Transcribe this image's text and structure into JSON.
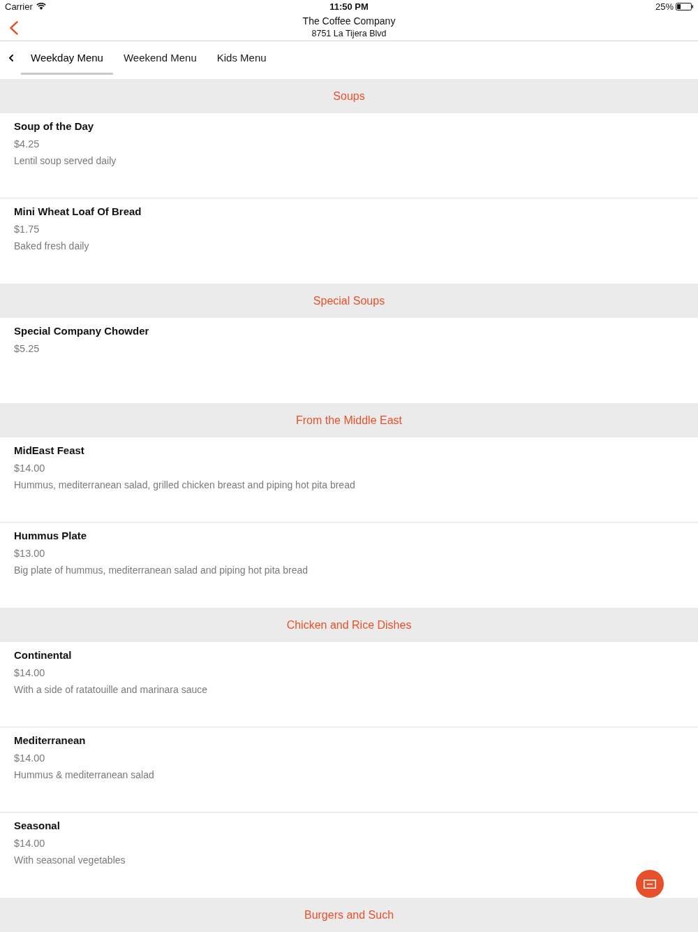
{
  "status_bar": {
    "carrier": "Carrier",
    "time": "11:50 PM",
    "battery": "25%"
  },
  "nav": {
    "title": "The Coffee Company",
    "subtitle": "8751 La Tijera Blvd"
  },
  "tabs": [
    {
      "label": "Weekday Menu",
      "selected": true
    },
    {
      "label": "Weekend Menu",
      "selected": false
    },
    {
      "label": "Kids Menu",
      "selected": false
    }
  ],
  "sections": [
    {
      "title": "Soups",
      "items": [
        {
          "name": "Soup of the Day",
          "price": "$4.25",
          "description": "Lentil soup served daily"
        },
        {
          "name": "Mini Wheat Loaf Of Bread",
          "price": "$1.75",
          "description": "Baked fresh daily"
        }
      ]
    },
    {
      "title": "Special Soups",
      "items": [
        {
          "name": "Special Company Chowder",
          "price": "$5.25"
        }
      ]
    },
    {
      "title": "From the Middle East",
      "items": [
        {
          "name": "MidEast Feast",
          "price": "$14.00",
          "description": "Hummus, mediterranean salad, grilled chicken breast and piping hot pita bread"
        },
        {
          "name": "Hummus Plate",
          "price": "$13.00",
          "description": "Big plate of hummus, mediterranean salad and piping hot pita bread"
        }
      ]
    },
    {
      "title": "Chicken and Rice Dishes",
      "items": [
        {
          "name": "Continental",
          "price": "$14.00",
          "description": "With a side of ratatouille and marinara sauce"
        },
        {
          "name": "Mediterranean",
          "price": "$14.00",
          "description": "Hummus & mediterranean salad"
        },
        {
          "name": "Seasonal",
          "price": "$14.00",
          "description": "With seasonal vegetables"
        }
      ]
    },
    {
      "title": "Burgers and Such"
    }
  ]
}
